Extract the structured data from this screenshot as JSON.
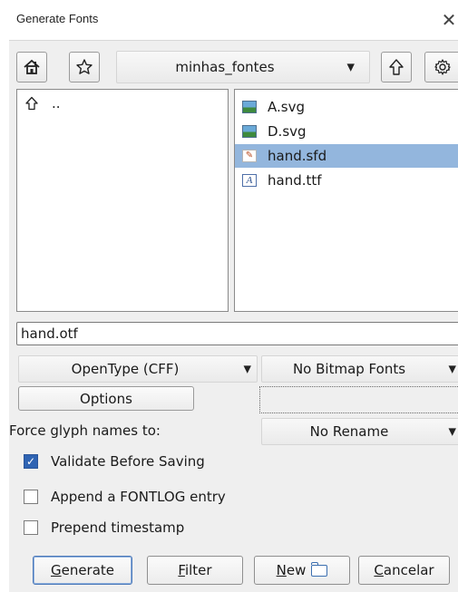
{
  "window": {
    "title": "Generate Fonts",
    "close_glyph": "✕"
  },
  "toolbar": {
    "home_icon": "home-icon",
    "bookmark_icon": "star-icon",
    "directory_value": "minhas_fontes",
    "up_icon": "arrow-up-icon",
    "settings_icon": "gear-icon"
  },
  "dir_list": {
    "items": [
      {
        "icon": "arrow-up-icon",
        "label": ".."
      }
    ]
  },
  "file_list": {
    "items": [
      {
        "icon": "image-icon",
        "label": "A.svg",
        "selected": false
      },
      {
        "icon": "image-icon",
        "label": "D.svg",
        "selected": false
      },
      {
        "icon": "sfd-file-icon",
        "label": "hand.sfd",
        "selected": true
      },
      {
        "icon": "font-file-icon",
        "label": "hand.ttf",
        "selected": false
      }
    ]
  },
  "filename_input": {
    "value": "hand.otf"
  },
  "format": {
    "outline_value": "OpenType (CFF)",
    "bitmap_value": "No Bitmap Fonts"
  },
  "options": {
    "options_label": "Options",
    "force_glyph_label": "Force glyph names to:",
    "rename_value": "No Rename"
  },
  "checkboxes": [
    {
      "label": "Validate Before Saving",
      "checked": true
    },
    {
      "label": "Append a FONTLOG entry",
      "checked": false
    },
    {
      "label": "Prepend timestamp",
      "checked": false
    }
  ],
  "actions": {
    "generate_label": "Generate",
    "filter_label": "Filter",
    "new_label": "New",
    "cancel_label": "Cancelar"
  },
  "colors": {
    "selection": "#93b6dd",
    "checked": "#2f64b3"
  }
}
